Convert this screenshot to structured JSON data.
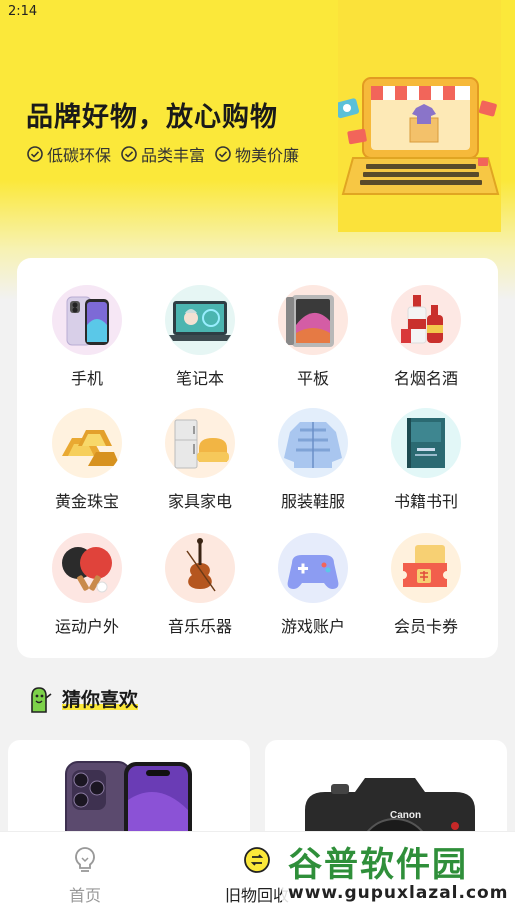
{
  "status": {
    "time": "2:14"
  },
  "banner": {
    "title": "品牌好物，放心购物",
    "tags": [
      "低碳环保",
      "品类丰富",
      "物美价廉"
    ]
  },
  "categories": [
    {
      "label": "手机",
      "icon": "phone-icon"
    },
    {
      "label": "笔记本",
      "icon": "laptop-icon"
    },
    {
      "label": "平板",
      "icon": "tablet-icon"
    },
    {
      "label": "名烟名酒",
      "icon": "liquor-icon"
    },
    {
      "label": "黄金珠宝",
      "icon": "gold-icon"
    },
    {
      "label": "家具家电",
      "icon": "appliance-icon"
    },
    {
      "label": "服装鞋服",
      "icon": "jacket-icon"
    },
    {
      "label": "书籍书刊",
      "icon": "book-icon"
    },
    {
      "label": "运动户外",
      "icon": "pingpong-icon"
    },
    {
      "label": "音乐乐器",
      "icon": "violin-icon"
    },
    {
      "label": "游戏账户",
      "icon": "gamepad-icon"
    },
    {
      "label": "会员卡券",
      "icon": "coupon-icon"
    }
  ],
  "section": {
    "title": "猜你喜欢"
  },
  "products": [
    {
      "icon": "iphone-icon",
      "badge": ""
    },
    {
      "icon": "camera-icon",
      "brand": "Canon"
    }
  ],
  "tabs": [
    {
      "label": "首页",
      "icon": "bulb-icon",
      "active": false
    },
    {
      "label": "旧物回收",
      "icon": "recycle-icon",
      "active": true
    }
  ],
  "watermark": {
    "title": "谷普软件园",
    "url": "www.gupuxlazal.com"
  },
  "colors": {
    "accent": "#fbe83a",
    "tab_active": "#222222",
    "tab_inactive": "#999999",
    "watermark_green": "#2f8f3a"
  }
}
